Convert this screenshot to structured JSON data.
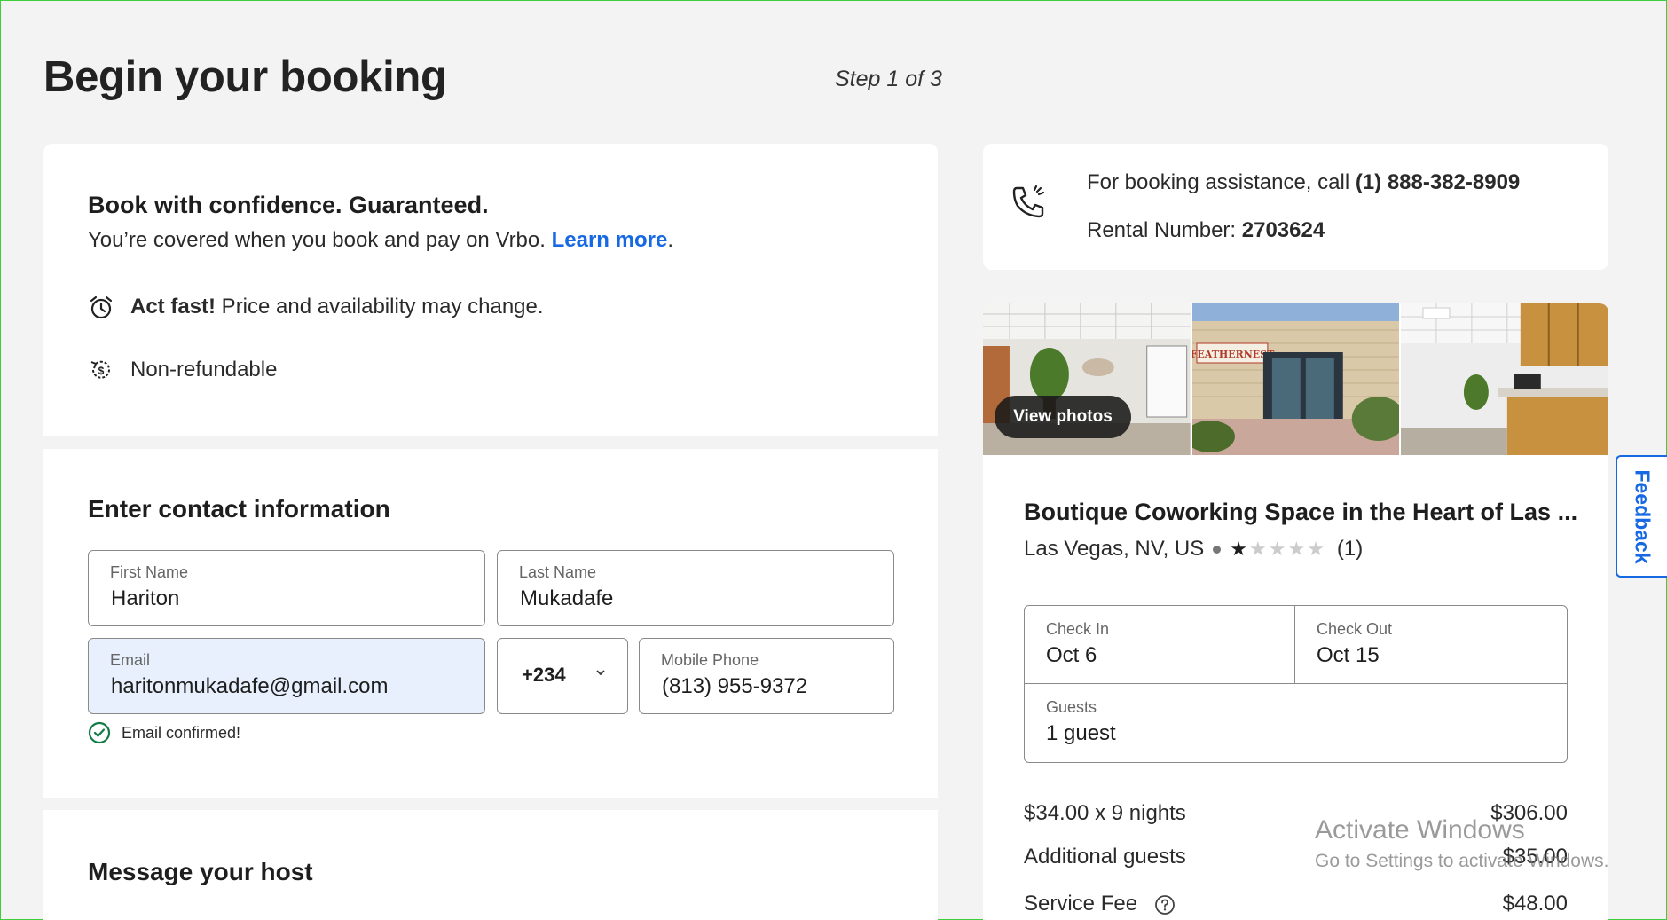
{
  "header": {
    "title": "Begin your booking",
    "step": "Step 1 of 3"
  },
  "confidence": {
    "heading": "Book with confidence. Guaranteed.",
    "covered_text": "You’re covered when you book and pay on Vrbo. ",
    "learn_more": "Learn more",
    "period": ".",
    "act_fast_bold": "Act fast!",
    "act_fast_text": " Price and availability may change.",
    "non_refundable": "Non-refundable"
  },
  "contact": {
    "heading": "Enter contact information",
    "first_name": {
      "label": "First Name",
      "value": "Hariton"
    },
    "last_name": {
      "label": "Last Name",
      "value": "Mukadafe"
    },
    "email": {
      "label": "Email",
      "value": "haritonmukadafe@gmail.com"
    },
    "country_code": "+234",
    "mobile": {
      "label": "Mobile Phone",
      "value": "(813) 955-9372"
    },
    "email_confirmed": "Email confirmed!"
  },
  "message": {
    "heading": "Message your host"
  },
  "assist": {
    "text": "For booking assistance, call ",
    "phone": "(1) 888-382-8909",
    "rental_label": "Rental Number: ",
    "rental_number": "2703624"
  },
  "property": {
    "view_photos": "View photos",
    "name": "Boutique Coworking Space in the Heart of Las ...",
    "location": "Las Vegas, NV, US",
    "rating": 1,
    "rating_max": 5,
    "review_count": "(1)",
    "check_in": {
      "label": "Check In",
      "value": "Oct 6"
    },
    "check_out": {
      "label": "Check Out",
      "value": "Oct 15"
    },
    "guests": {
      "label": "Guests",
      "value": "1 guest"
    },
    "prices": [
      {
        "label": "$34.00 x 9 nights",
        "amount": "$306.00"
      },
      {
        "label": "Additional guests",
        "amount": "$35.00"
      },
      {
        "label": "Service Fee",
        "amount": "$48.00"
      }
    ]
  },
  "feedback": "Feedback",
  "watermark": {
    "title": "Activate Windows",
    "subtitle": "Go to Settings to activate Windows."
  },
  "colors": {
    "accent": "#1668e3",
    "success": "#117a45",
    "email_bg": "#e8f0fe"
  }
}
